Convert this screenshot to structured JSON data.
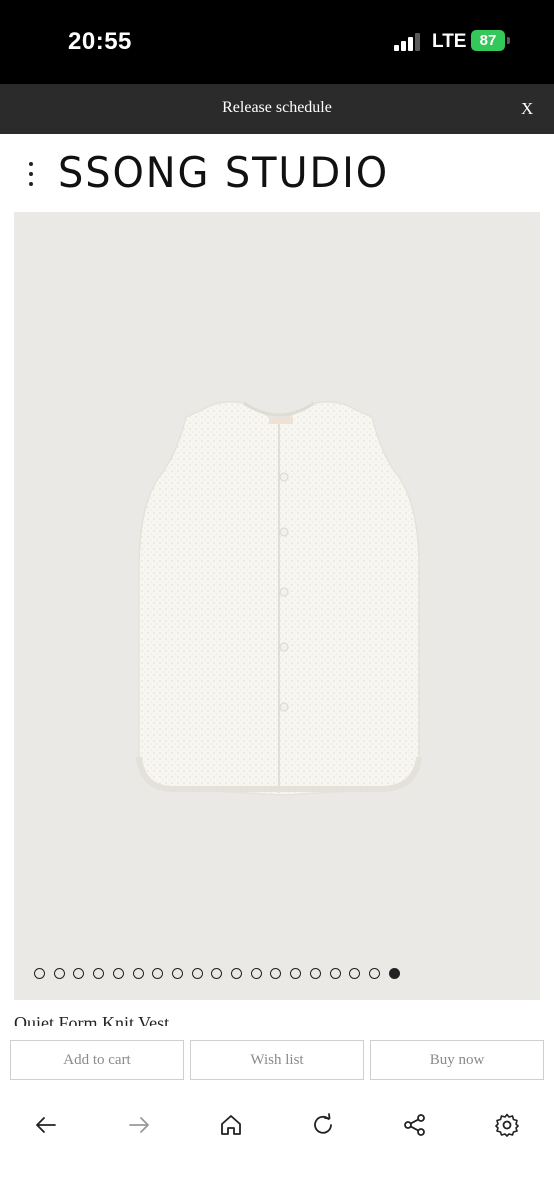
{
  "status_bar": {
    "time": "20:55",
    "network": "LTE",
    "battery": "87"
  },
  "banner": {
    "text": "Release schedule",
    "close_label": "X"
  },
  "header": {
    "logo": "SSONG STUDIO",
    "menu_icon": "kebab-menu-icon"
  },
  "product": {
    "name": "Quiet Form Knit Vest",
    "image_count": 19,
    "current_image": 19
  },
  "actions": {
    "add_to_cart": "Add to cart",
    "wish_list": "Wish list",
    "buy_now": "Buy now"
  },
  "browser_nav": {
    "icons": [
      "back-arrow-icon",
      "forward-arrow-icon",
      "home-icon",
      "reload-icon",
      "share-icon",
      "settings-icon"
    ]
  },
  "colors": {
    "banner_bg": "#2b2b2b",
    "image_bg": "#ebe9e6",
    "battery": "#34c759"
  }
}
